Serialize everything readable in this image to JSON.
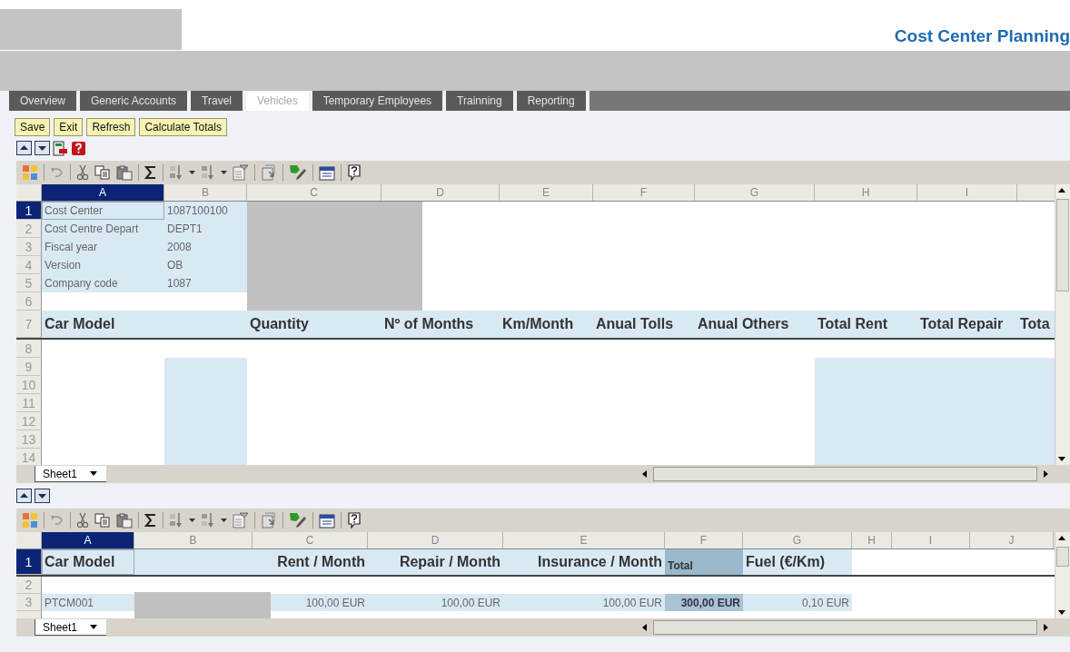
{
  "header": {
    "title": "Cost Center Planning"
  },
  "tabs": [
    {
      "label": "Overview",
      "selected": false
    },
    {
      "label": "Generic Accounts",
      "selected": false
    },
    {
      "label": "Travel",
      "selected": false
    },
    {
      "label": "Vehicles",
      "selected": true
    },
    {
      "label": "Temporary Employees",
      "selected": false
    },
    {
      "label": "Trainning",
      "selected": false
    },
    {
      "label": "Reporting",
      "selected": false
    }
  ],
  "buttons": [
    "Save",
    "Exit",
    "Refresh",
    "Calculate Totals"
  ],
  "sheets": [
    {
      "tab": "Sheet1",
      "columns": [
        {
          "label": "A",
          "selected": true
        },
        {
          "label": "B",
          "selected": false
        },
        {
          "label": "C",
          "selected": false
        },
        {
          "label": "D",
          "selected": false
        },
        {
          "label": "E",
          "selected": false
        },
        {
          "label": "F",
          "selected": false
        },
        {
          "label": "G",
          "selected": false
        },
        {
          "label": "H",
          "selected": false
        },
        {
          "label": "I",
          "selected": false
        }
      ],
      "rows": [
        {
          "number": "1",
          "selected": true,
          "kind": "data",
          "cells": [
            {
              "kind": "text",
              "text": "Cost Center"
            },
            {
              "kind": "text",
              "text": "1087100100"
            }
          ]
        },
        {
          "number": "2",
          "selected": false,
          "kind": "data",
          "cells": [
            {
              "kind": "text",
              "text": "Cost Centre Depart"
            },
            {
              "kind": "text",
              "text": "DEPT1"
            }
          ]
        },
        {
          "number": "3",
          "selected": false,
          "kind": "data",
          "cells": [
            {
              "kind": "text",
              "text": "Fiscal year"
            },
            {
              "kind": "text",
              "text": "2008"
            }
          ]
        },
        {
          "number": "4",
          "selected": false,
          "kind": "data",
          "cells": [
            {
              "kind": "text",
              "text": "Version"
            },
            {
              "kind": "text",
              "text": "OB"
            }
          ]
        },
        {
          "number": "5",
          "selected": false,
          "kind": "data",
          "cells": [
            {
              "kind": "text",
              "text": "Company code"
            },
            {
              "kind": "text",
              "text": "1087"
            }
          ]
        },
        {
          "number": "6",
          "selected": false,
          "kind": "data",
          "cells": []
        },
        {
          "number": "7",
          "selected": false,
          "kind": "heading",
          "cells": [
            {
              "kind": "heading",
              "text": "Car Model"
            },
            {
              "kind": "blank"
            },
            {
              "kind": "heading",
              "text": "Quantity"
            },
            {
              "kind": "heading",
              "text": "Nº of Months"
            },
            {
              "kind": "heading",
              "text": "Km/Month"
            },
            {
              "kind": "heading",
              "text": "Anual Tolls"
            },
            {
              "kind": "heading",
              "text": "Anual Others"
            },
            {
              "kind": "heading",
              "text": "Total Rent"
            },
            {
              "kind": "heading",
              "text": "Total Repair"
            },
            {
              "kind": "heading",
              "text": "Tota"
            }
          ]
        },
        {
          "number": "8",
          "selected": false,
          "kind": "data",
          "cells": []
        },
        {
          "number": "9",
          "selected": false,
          "kind": "data",
          "cells": [
            {
              "kind": "blank"
            },
            {
              "kind": "input"
            },
            {
              "kind": "blank"
            },
            {
              "kind": "blank"
            },
            {
              "kind": "blank"
            },
            {
              "kind": "blank"
            },
            {
              "kind": "blank"
            },
            {
              "kind": "input"
            },
            {
              "kind": "input"
            },
            {
              "kind": "input"
            }
          ]
        },
        {
          "number": "10",
          "selected": false,
          "kind": "data",
          "cells": [
            {
              "kind": "blank"
            },
            {
              "kind": "input"
            },
            {
              "kind": "blank"
            },
            {
              "kind": "blank"
            },
            {
              "kind": "blank"
            },
            {
              "kind": "blank"
            },
            {
              "kind": "blank"
            },
            {
              "kind": "input"
            },
            {
              "kind": "input"
            },
            {
              "kind": "input"
            }
          ]
        },
        {
          "number": "11",
          "selected": false,
          "kind": "data",
          "cells": [
            {
              "kind": "blank"
            },
            {
              "kind": "input"
            },
            {
              "kind": "blank"
            },
            {
              "kind": "blank"
            },
            {
              "kind": "blank"
            },
            {
              "kind": "blank"
            },
            {
              "kind": "blank"
            },
            {
              "kind": "input"
            },
            {
              "kind": "input"
            },
            {
              "kind": "input"
            }
          ]
        },
        {
          "number": "12",
          "selected": false,
          "kind": "data",
          "cells": [
            {
              "kind": "blank"
            },
            {
              "kind": "input"
            },
            {
              "kind": "blank"
            },
            {
              "kind": "blank"
            },
            {
              "kind": "blank"
            },
            {
              "kind": "blank"
            },
            {
              "kind": "blank"
            },
            {
              "kind": "input"
            },
            {
              "kind": "input"
            },
            {
              "kind": "input"
            }
          ]
        },
        {
          "number": "13",
          "selected": false,
          "kind": "data",
          "cells": [
            {
              "kind": "blank"
            },
            {
              "kind": "input"
            },
            {
              "kind": "blank"
            },
            {
              "kind": "blank"
            },
            {
              "kind": "blank"
            },
            {
              "kind": "blank"
            },
            {
              "kind": "blank"
            },
            {
              "kind": "input"
            },
            {
              "kind": "input"
            },
            {
              "kind": "input"
            }
          ]
        },
        {
          "number": "14",
          "selected": false,
          "kind": "data",
          "cells": [
            {
              "kind": "blank"
            },
            {
              "kind": "input"
            },
            {
              "kind": "blank"
            },
            {
              "kind": "blank"
            },
            {
              "kind": "blank"
            },
            {
              "kind": "blank"
            },
            {
              "kind": "blank"
            },
            {
              "kind": "input"
            },
            {
              "kind": "input"
            },
            {
              "kind": "input"
            }
          ]
        }
      ]
    },
    {
      "tab": "Sheet1",
      "columns": [
        {
          "label": "A",
          "selected": true
        },
        {
          "label": "B",
          "selected": false
        },
        {
          "label": "C",
          "selected": false
        },
        {
          "label": "D",
          "selected": false
        },
        {
          "label": "E",
          "selected": false
        },
        {
          "label": "F",
          "selected": false
        },
        {
          "label": "G",
          "selected": false
        },
        {
          "label": "H",
          "selected": false
        },
        {
          "label": "I",
          "selected": false
        },
        {
          "label": "J",
          "selected": false
        }
      ],
      "rows": [
        {
          "number": "1",
          "selected": true,
          "kind": "heading",
          "cells": [
            {
              "kind": "heading",
              "text": "Car Model"
            },
            {
              "kind": "input"
            },
            {
              "kind": "heading_end",
              "text": "Rent / Month"
            },
            {
              "kind": "heading_end",
              "text": "Repair / Month"
            },
            {
              "kind": "heading_end",
              "text": "Insurance / Month"
            },
            {
              "kind": "total_heading",
              "text": "Total"
            },
            {
              "kind": "heading",
              "text": "Fuel (€/Km)"
            }
          ]
        },
        {
          "number": "2",
          "selected": false,
          "kind": "data",
          "cells": []
        },
        {
          "number": "3",
          "selected": false,
          "kind": "data",
          "cells": [
            {
              "kind": "text",
              "text": "PTCM001"
            },
            {
              "kind": "input"
            },
            {
              "kind": "amount",
              "text": "100,00 EUR"
            },
            {
              "kind": "amount",
              "text": "100,00 EUR"
            },
            {
              "kind": "amount",
              "text": "100,00 EUR"
            },
            {
              "kind": "total_amount",
              "text": "300,00 EUR"
            },
            {
              "kind": "amount",
              "text": "0,10 EUR"
            }
          ]
        }
      ]
    }
  ]
}
